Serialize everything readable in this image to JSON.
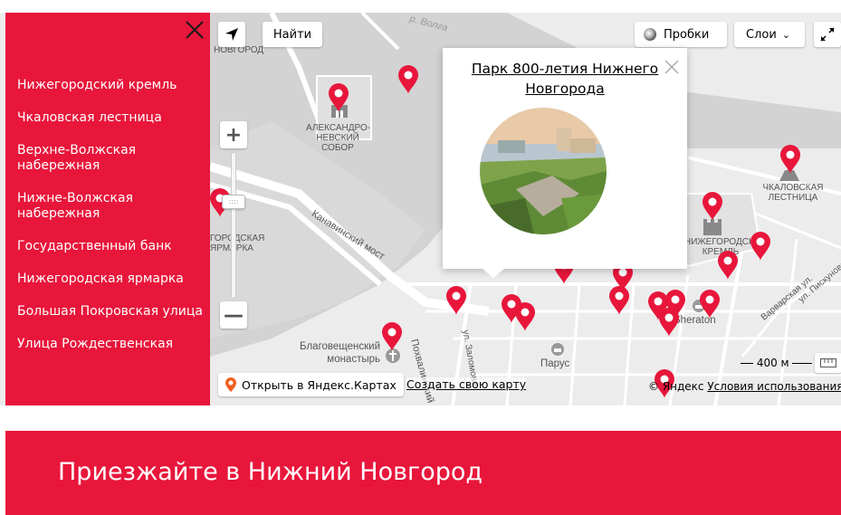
{
  "sidebar": {
    "items": [
      "Нижегородский кремль",
      "Чкаловская лестница",
      "Верхне-Волжская набережная",
      "Нижне-Волжская набережная",
      "Государственный банк",
      "Нижегородская ярмарка",
      "Большая Покровская улица",
      "Улица Рождественская"
    ]
  },
  "map": {
    "controls": {
      "find": "Найти",
      "traffic": "Пробки",
      "layers": "Слои",
      "open_yandex": "Открыть в Яндекс.Картах",
      "create_map": "Создать свою карту",
      "copyright": "© Яндекс",
      "terms": "Условия использования",
      "scale": "400 м"
    },
    "labels": {
      "river": "р. Волга",
      "sobor": [
        "АЛЕКСАНДРО-",
        "НЕВСКИЙ",
        "СОБОР"
      ],
      "chkalov": [
        "ЧКАЛОВСКАЯ",
        "ЛЕСТНИЦА"
      ],
      "kreml": [
        "НИЖЕГОРОДСКИЙ",
        "КРЕМЛЬ"
      ],
      "yarmarka": [
        "ГОРОДСКАЯ",
        "ЯРМАРКА"
      ],
      "most": "Канавинский мост",
      "monastery": [
        "Благовещенский",
        "монастырь"
      ],
      "parus": "Парус",
      "sheraton": "Sheraton",
      "pokhval": "Похвалинский",
      "zalomov": "ул. Заломова",
      "varvar": "Варварская ул.",
      "piskun": "ул. Пискунова",
      "novgorod": "НОВГОРОД"
    },
    "balloon": {
      "title": "Парк 800-летия Нижнего Новгорода"
    }
  },
  "banner": {
    "title": "Приезжайте в Нижний Новгород"
  },
  "colors": {
    "brand_red": "#e8163b",
    "marker_red": "#e8163b"
  }
}
